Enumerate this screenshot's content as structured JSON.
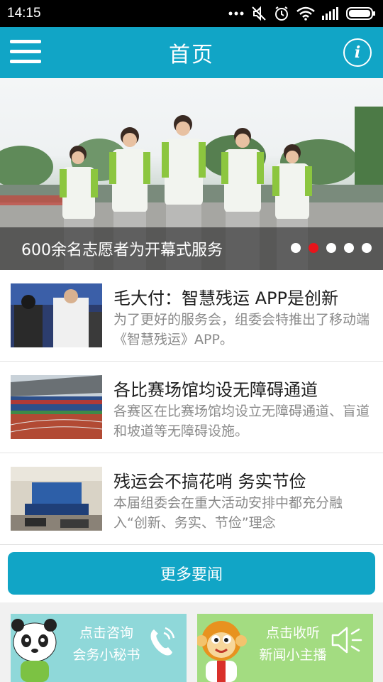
{
  "status_bar": {
    "time": "14:15",
    "icons": [
      "more-icon",
      "mute-icon",
      "alarm-icon",
      "wifi-icon",
      "signal-icon",
      "battery-icon"
    ]
  },
  "app_bar": {
    "title": "首页",
    "menu_icon": "menu-icon",
    "info_icon": "info-icon",
    "info_glyph": "i",
    "color": "#11a5c6"
  },
  "banner": {
    "caption": "600余名志愿者为开幕式服务",
    "slide_count": 5,
    "active_slide": 2
  },
  "news": [
    {
      "title": "毛大付：智慧残运 APP是创新",
      "description": "为了更好的服务会，组委会特推出了移动端《智慧残运》APP。"
    },
    {
      "title": "各比赛场馆均设无障碍通道",
      "description": "各赛区在比赛场馆均设立无障碍通道、盲道和坡道等无障碍设施。"
    },
    {
      "title": "残运会不搞花哨 务实节俭",
      "description": "本届组委会在重大活动安排中都充分融入“创新、务实、节俭”理念"
    }
  ],
  "more_button": {
    "label": "更多要闻"
  },
  "cards": [
    {
      "line1": "点击咨询",
      "line2": "会务小秘书",
      "icon": "phone-icon",
      "mascot": "panda-mascot",
      "color": "#8fd8d9"
    },
    {
      "line1": "点击收听",
      "line2": "新闻小主播",
      "icon": "speaker-icon",
      "mascot": "monkey-mascot",
      "color": "#a3dc81"
    }
  ]
}
